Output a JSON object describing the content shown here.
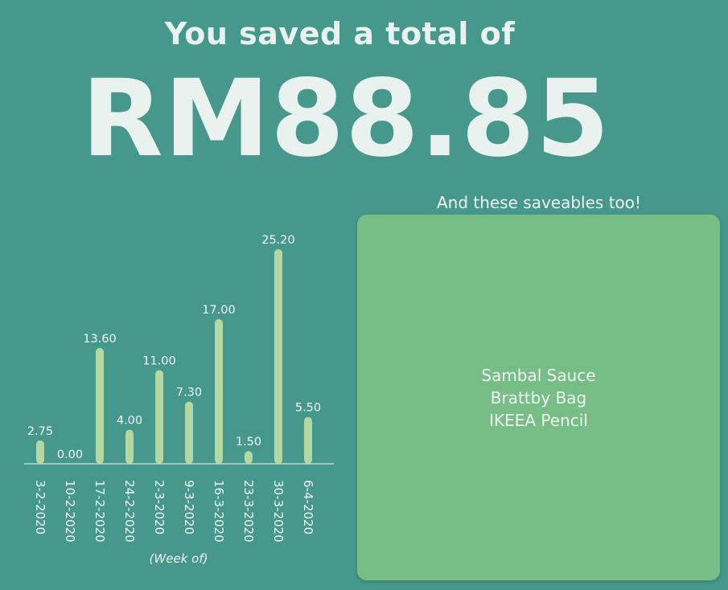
{
  "header": {
    "headline": "You saved a total of",
    "total": "RM88.85"
  },
  "chart_data": {
    "type": "bar",
    "categories": [
      "3-2-2020",
      "10-2-2020",
      "17-2-2020",
      "24-2-2020",
      "2-3-2020",
      "9-3-2020",
      "16-3-2020",
      "23-3-2020",
      "30-3-2020",
      "6-4-2020"
    ],
    "values": [
      2.75,
      0.0,
      13.6,
      4.0,
      11.0,
      7.3,
      17.0,
      1.5,
      25.2,
      5.5
    ],
    "value_labels": [
      "2.75",
      "0.00",
      "13.60",
      "4.00",
      "11.00",
      "7.30",
      "17.00",
      "1.50",
      "25.20",
      "5.50"
    ],
    "title": "",
    "xlabel": "(Week of)",
    "ylabel": "",
    "ylim": [
      0,
      25.2
    ],
    "grid": false,
    "colors": {
      "bar": "#b3d8a2",
      "baseline": "#d8e6e2",
      "text": "#f0f5f3"
    }
  },
  "saveables": {
    "title": "And these saveables too!",
    "items": [
      "Sambal Sauce",
      "Brattby Bag",
      "IKEEA Pencil"
    ]
  },
  "colors": {
    "background": "#46988d",
    "card": "#77be86",
    "text": "#eef4f2"
  }
}
